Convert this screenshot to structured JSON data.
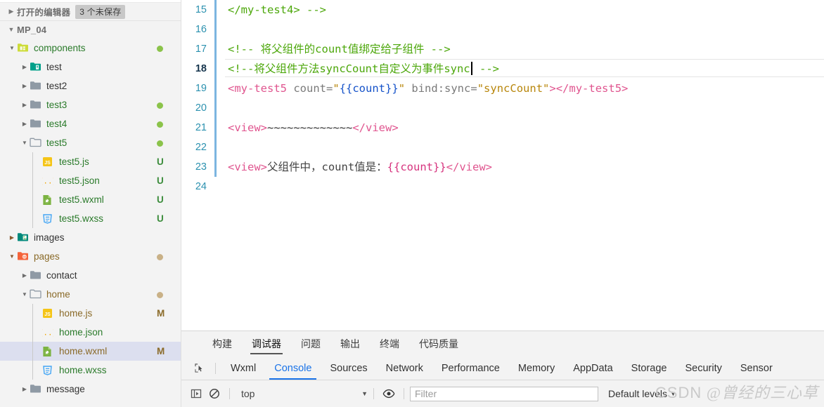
{
  "sidebar": {
    "open_editors": {
      "label": "打开的编辑器",
      "badge": "3 个未保存",
      "twisty": "▶"
    },
    "project": {
      "label": "MP_04",
      "twisty": "▼"
    },
    "items": [
      {
        "label": "components",
        "type": "folder",
        "icon": "folder-components-icon",
        "depth": 1,
        "twisty": "▼",
        "status": "",
        "status_type": "dot-green",
        "selected": false
      },
      {
        "label": "test",
        "type": "folder",
        "icon": "folder-teal-icon",
        "depth": 2,
        "twisty": "▶",
        "status": "",
        "status_type": "none",
        "selected": false
      },
      {
        "label": "test2",
        "type": "folder",
        "icon": "folder-gray-icon",
        "depth": 2,
        "twisty": "▶",
        "status": "",
        "status_type": "none",
        "selected": false
      },
      {
        "label": "test3",
        "type": "folder",
        "icon": "folder-gray-icon",
        "depth": 2,
        "twisty": "▶",
        "status": "",
        "status_type": "dot-green",
        "selected": false
      },
      {
        "label": "test4",
        "type": "folder",
        "icon": "folder-gray-icon",
        "depth": 2,
        "twisty": "▶",
        "status": "",
        "status_type": "dot-green",
        "selected": false
      },
      {
        "label": "test5",
        "type": "folder",
        "icon": "folder-gray-open-icon",
        "depth": 2,
        "twisty": "▼",
        "status": "",
        "status_type": "dot-green",
        "selected": false
      },
      {
        "label": "test5.js",
        "type": "file",
        "icon": "js-file-icon",
        "depth": 3,
        "twisty": "",
        "status": "U",
        "status_type": "text-green",
        "selected": false
      },
      {
        "label": "test5.json",
        "type": "file",
        "icon": "json-file-icon",
        "depth": 3,
        "twisty": "",
        "status": "U",
        "status_type": "text-green",
        "selected": false
      },
      {
        "label": "test5.wxml",
        "type": "file",
        "icon": "wxml-file-icon",
        "depth": 3,
        "twisty": "",
        "status": "U",
        "status_type": "text-green",
        "selected": false
      },
      {
        "label": "test5.wxss",
        "type": "file",
        "icon": "wxss-file-icon",
        "depth": 3,
        "twisty": "",
        "status": "U",
        "status_type": "text-green",
        "selected": false
      },
      {
        "label": "images",
        "type": "folder",
        "icon": "folder-images-icon",
        "depth": 1,
        "twisty": "▶",
        "status": "",
        "status_type": "none",
        "selected": false
      },
      {
        "label": "pages",
        "type": "folder",
        "icon": "folder-pages-icon",
        "depth": 1,
        "twisty": "▼",
        "status": "",
        "status_type": "dot-tan",
        "selected": false
      },
      {
        "label": "contact",
        "type": "folder",
        "icon": "folder-gray-icon",
        "depth": 2,
        "twisty": "▶",
        "status": "",
        "status_type": "none",
        "selected": false
      },
      {
        "label": "home",
        "type": "folder",
        "icon": "folder-gray-open-icon",
        "depth": 2,
        "twisty": "▼",
        "status": "",
        "status_type": "dot-tan",
        "selected": false
      },
      {
        "label": "home.js",
        "type": "file",
        "icon": "js-file-icon",
        "depth": 3,
        "twisty": "",
        "status": "M",
        "status_type": "text-tan",
        "selected": false
      },
      {
        "label": "home.json",
        "type": "file",
        "icon": "json-file-icon",
        "depth": 3,
        "twisty": "",
        "status": "",
        "status_type": "none",
        "selected": false
      },
      {
        "label": "home.wxml",
        "type": "file",
        "icon": "wxml-file-icon",
        "depth": 3,
        "twisty": "",
        "status": "M",
        "status_type": "text-tan",
        "selected": true
      },
      {
        "label": "home.wxss",
        "type": "file",
        "icon": "wxss-file-icon",
        "depth": 3,
        "twisty": "",
        "status": "",
        "status_type": "none",
        "selected": false
      },
      {
        "label": "message",
        "type": "folder",
        "icon": "folder-gray-icon",
        "depth": 2,
        "twisty": "▶",
        "status": "",
        "status_type": "none",
        "selected": false
      }
    ]
  },
  "editor": {
    "first_line_number": 15,
    "active_line": 18,
    "lines": [
      {
        "n": 15,
        "tokens": [
          {
            "t": "</my-test4> -->",
            "c": "c-comment"
          }
        ]
      },
      {
        "n": 16,
        "tokens": []
      },
      {
        "n": 17,
        "tokens": [
          {
            "t": "<!-- 将父组件的count值绑定给子组件 -->",
            "c": "c-comment"
          }
        ]
      },
      {
        "n": 18,
        "tokens": [
          {
            "t": "<!--将父组件方法syncCount自定义为事件sync",
            "c": "c-comment"
          },
          {
            "t": "|caret|",
            "c": "caret"
          },
          {
            "t": " -->",
            "c": "c-comment"
          }
        ]
      },
      {
        "n": 19,
        "tokens": [
          {
            "t": "<my-test5",
            "c": "c-tagname"
          },
          {
            "t": " count",
            "c": "c-attr"
          },
          {
            "t": "=",
            "c": "c-eq"
          },
          {
            "t": "\"",
            "c": "c-str"
          },
          {
            "t": "{{count}}",
            "c": "c-mustache"
          },
          {
            "t": "\"",
            "c": "c-str"
          },
          {
            "t": " bind:sync",
            "c": "c-attr"
          },
          {
            "t": "=",
            "c": "c-eq"
          },
          {
            "t": "\"syncCount\"",
            "c": "c-str"
          },
          {
            "t": ">",
            "c": "c-tagname"
          },
          {
            "t": "</my-test5>",
            "c": "c-tagname"
          }
        ]
      },
      {
        "n": 20,
        "tokens": []
      },
      {
        "n": 21,
        "tokens": [
          {
            "t": "<view>",
            "c": "c-tag"
          },
          {
            "t": "~~~~~~~~~~~~~",
            "c": "c-tilde"
          },
          {
            "t": "</view>",
            "c": "c-tag"
          }
        ]
      },
      {
        "n": 22,
        "tokens": []
      },
      {
        "n": 23,
        "tokens": [
          {
            "t": "<view>",
            "c": "c-tag"
          },
          {
            "t": "父组件中，count值是：",
            "c": "c-plain"
          },
          {
            "t": "{{count}}",
            "c": "c-mustache-pink"
          },
          {
            "t": "</view>",
            "c": "c-tag"
          }
        ]
      },
      {
        "n": 24,
        "tokens": []
      }
    ]
  },
  "devtools": {
    "outer_tabs": [
      {
        "label": "构建",
        "active": false
      },
      {
        "label": "调试器",
        "active": true
      },
      {
        "label": "问题",
        "active": false
      },
      {
        "label": "输出",
        "active": false
      },
      {
        "label": "终端",
        "active": false
      },
      {
        "label": "代码质量",
        "active": false
      }
    ],
    "panel_tabs": [
      {
        "label": "Wxml",
        "active": false
      },
      {
        "label": "Console",
        "active": true
      },
      {
        "label": "Sources",
        "active": false
      },
      {
        "label": "Network",
        "active": false
      },
      {
        "label": "Performance",
        "active": false
      },
      {
        "label": "Memory",
        "active": false
      },
      {
        "label": "AppData",
        "active": false
      },
      {
        "label": "Storage",
        "active": false
      },
      {
        "label": "Security",
        "active": false
      },
      {
        "label": "Sensor",
        "active": false
      }
    ],
    "console_bar": {
      "context": "top",
      "context_arrow": "▼",
      "filter_placeholder": "Filter",
      "levels_label": "Default levels",
      "levels_arrow": "▼"
    }
  },
  "watermark": {
    "prefix": "CSDN",
    "text": "@曾经的三心草"
  },
  "colors": {
    "accent_blue": "#1a73e8",
    "comment_green": "#4ca70a",
    "tag_pink": "#e0558f",
    "string_gold": "#b8860b",
    "selection": "#dcdfef",
    "sidebar_bg": "#f3f3f3"
  }
}
